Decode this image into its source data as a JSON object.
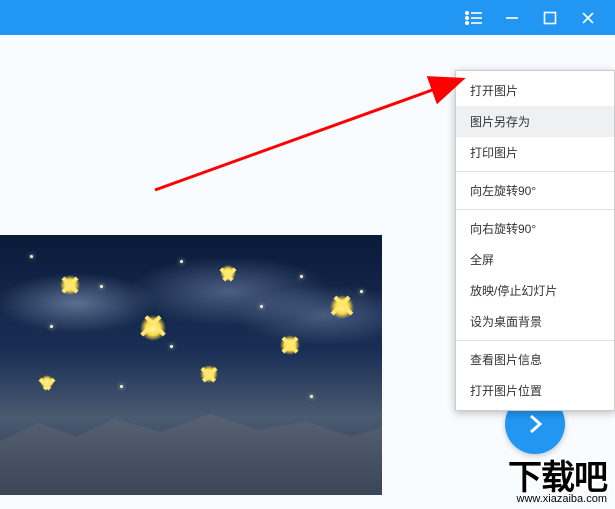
{
  "titlebar": {
    "menu_icon": "menu-list",
    "minimize_icon": "minimize",
    "maximize_icon": "maximize",
    "close_icon": "close"
  },
  "context_menu": {
    "groups": [
      [
        {
          "label": "打开图片",
          "name": "menu-open-image",
          "hover": false
        },
        {
          "label": "图片另存为",
          "name": "menu-save-image-as",
          "hover": true
        },
        {
          "label": "打印图片",
          "name": "menu-print-image",
          "hover": false
        }
      ],
      [
        {
          "label": "向左旋转90°",
          "name": "menu-rotate-left",
          "hover": false
        }
      ],
      [
        {
          "label": "向右旋转90°",
          "name": "menu-rotate-right",
          "hover": false
        },
        {
          "label": "全屏",
          "name": "menu-fullscreen",
          "hover": false
        },
        {
          "label": "放映/停止幻灯片",
          "name": "menu-slideshow",
          "hover": false
        },
        {
          "label": "设为桌面背景",
          "name": "menu-set-wallpaper",
          "hover": false
        }
      ],
      [
        {
          "label": "查看图片信息",
          "name": "menu-image-info",
          "hover": false
        },
        {
          "label": "打开图片位置",
          "name": "menu-open-location",
          "hover": false
        }
      ]
    ]
  },
  "navigation": {
    "next_icon": "chevron-right"
  },
  "watermark": {
    "main": "下载吧",
    "sub": "www.xiazaiba.com"
  },
  "annotation": {
    "arrow_color": "#ff0000"
  }
}
